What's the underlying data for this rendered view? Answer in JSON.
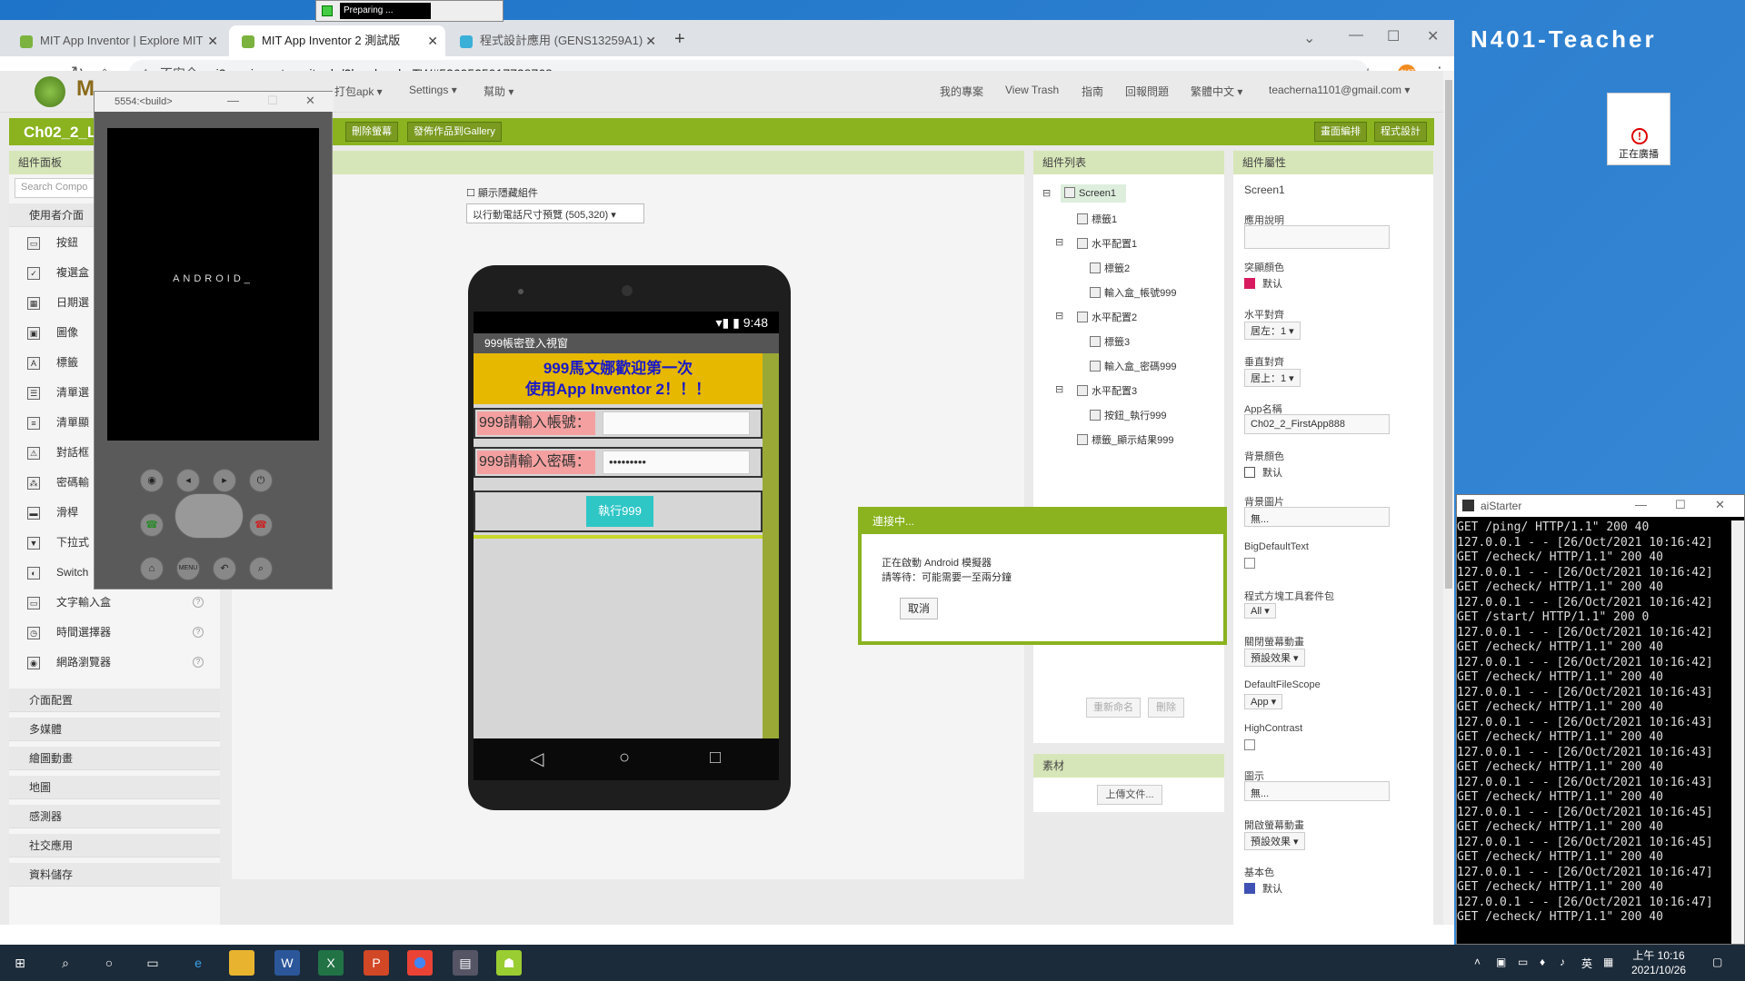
{
  "desktop": {
    "label": "N401-Teacher",
    "broadcast": "正在廣播",
    "preparing": "Preparing ..."
  },
  "browser": {
    "tabs": [
      "MIT App Inventor | Explore MIT",
      "MIT App Inventor 2 測試版",
      "程式設計應用 (GENS13259A1)"
    ],
    "not_secure": "不安全",
    "url": "ai2.appinventor.mit.edu/?locale=zh_TW#5269525917728768"
  },
  "topmenu": {
    "build": "打包apk ▾",
    "settings": "Settings ▾",
    "help": "幫助 ▾",
    "my_projects": "我的專案",
    "view_trash": "View Trash",
    "guide": "指南",
    "report": "回報問題",
    "language": "繁體中文 ▾",
    "account": "teacherna1101@gmail.com ▾"
  },
  "project": {
    "title": "Ch02_2_Lo",
    "delete_screen": "刪除螢幕",
    "publish": "發佈作品到Gallery",
    "designer": "畫面編排",
    "blocks": "程式設計"
  },
  "palette": {
    "header": "組件面板",
    "search_placeholder": "Search Compo",
    "category": "使用者介面",
    "items": [
      "按鈕",
      "複選盒",
      "日期選",
      "圖像",
      "標籤",
      "清單選",
      "清單顯",
      "對話框",
      "密碼輸",
      "滑桿",
      "下拉式",
      "Switch",
      "文字輸入盒",
      "時間選擇器",
      "網路瀏覽器"
    ],
    "categories": [
      "介面配置",
      "多媒體",
      "繪圖動畫",
      "地圖",
      "感測器",
      "社交應用",
      "資料儲存"
    ]
  },
  "viewer": {
    "show_hidden": "顯示隱藏組件",
    "size_select": "以行動電話尺寸預覽 (505,320)",
    "time": "9:48",
    "screen_title": "999帳密登入視窗",
    "welcome_line1": "999馬文娜歡迎第一次",
    "welcome_line2": "使用App Inventor 2！！！",
    "account_label": "999請輸入帳號：",
    "password_label": "999請輸入密碼：",
    "password_value": "•••••••••",
    "run_button": "執行999"
  },
  "emulator": {
    "title": "5554:<build>",
    "screen_text": "ANDROID_"
  },
  "components": {
    "header": "組件列表",
    "tree": [
      "Screen1",
      "標籤1",
      "水平配置1",
      "標籤2",
      "輸入盒_帳號999",
      "水平配置2",
      "標籤3",
      "輸入盒_密碼999",
      "水平配置3",
      "按鈕_執行999",
      "標籤_顯示結果999"
    ],
    "rename": "重新命名",
    "delete": "刪除"
  },
  "media": {
    "header": "素材",
    "upload": "上傳文件..."
  },
  "properties": {
    "header": "組件屬性",
    "component": "Screen1",
    "about_label": "應用說明",
    "accent_label": "突顯顏色",
    "default": "默认",
    "halign_label": "水平對齊",
    "halign_value": "居左：1 ▾",
    "valign_label": "垂直對齊",
    "valign_value": "居上：1 ▾",
    "appname_label": "App名稱",
    "appname_value": "Ch02_2_FirstApp888",
    "bgcolor_label": "背景顏色",
    "bgimage_label": "背景圖片",
    "none": "無...",
    "bigtext_label": "BigDefaultText",
    "blocks_toolkit_label": "程式方塊工具套件包",
    "blocks_toolkit_value": "All ▾",
    "close_anim_label": "關閉螢幕動畫",
    "anim_value": "預設效果 ▾",
    "filescope_label": "DefaultFileScope",
    "filescope_value": "App ▾",
    "highcontrast_label": "HighContrast",
    "icon_label": "圖示",
    "open_anim_label": "開啟螢幕動畫",
    "primary_label": "基本色",
    "accent_color": "#d81b60",
    "primary_color": "#3f51b5"
  },
  "dialog": {
    "title": "連接中...",
    "line1": "正在啟動 Android 模擬器",
    "line2": "請等待：可能需要一至兩分鐘",
    "cancel": "取消"
  },
  "aistarter": {
    "title": "aiStarter",
    "log": [
      "GET /ping/ HTTP/1.1\" 200 40",
      "127.0.0.1 - - [26/Oct/2021 10:16:42]",
      "GET /echeck/ HTTP/1.1\" 200 40",
      "127.0.0.1 - - [26/Oct/2021 10:16:42]",
      "GET /echeck/ HTTP/1.1\" 200 40",
      "127.0.0.1 - - [26/Oct/2021 10:16:42]",
      "GET /start/ HTTP/1.1\" 200 0",
      "127.0.0.1 - - [26/Oct/2021 10:16:42]",
      "GET /echeck/ HTTP/1.1\" 200 40",
      "127.0.0.1 - - [26/Oct/2021 10:16:42]",
      "GET /echeck/ HTTP/1.1\" 200 40",
      "127.0.0.1 - - [26/Oct/2021 10:16:43]",
      "GET /echeck/ HTTP/1.1\" 200 40",
      "127.0.0.1 - - [26/Oct/2021 10:16:43]",
      "GET /echeck/ HTTP/1.1\" 200 40",
      "127.0.0.1 - - [26/Oct/2021 10:16:43]",
      "GET /echeck/ HTTP/1.1\" 200 40",
      "127.0.0.1 - - [26/Oct/2021 10:16:43]",
      "GET /echeck/ HTTP/1.1\" 200 40",
      "127.0.0.1 - - [26/Oct/2021 10:16:45]",
      "GET /echeck/ HTTP/1.1\" 200 40",
      "127.0.0.1 - - [26/Oct/2021 10:16:45]",
      "GET /echeck/ HTTP/1.1\" 200 40",
      "127.0.0.1 - - [26/Oct/2021 10:16:47]",
      "GET /echeck/ HTTP/1.1\" 200 40",
      "127.0.0.1 - - [26/Oct/2021 10:16:47]",
      "GET /echeck/ HTTP/1.1\" 200 40"
    ]
  },
  "taskbar": {
    "time": "上午 10:16",
    "date": "2021/10/26",
    "ime": "英"
  }
}
